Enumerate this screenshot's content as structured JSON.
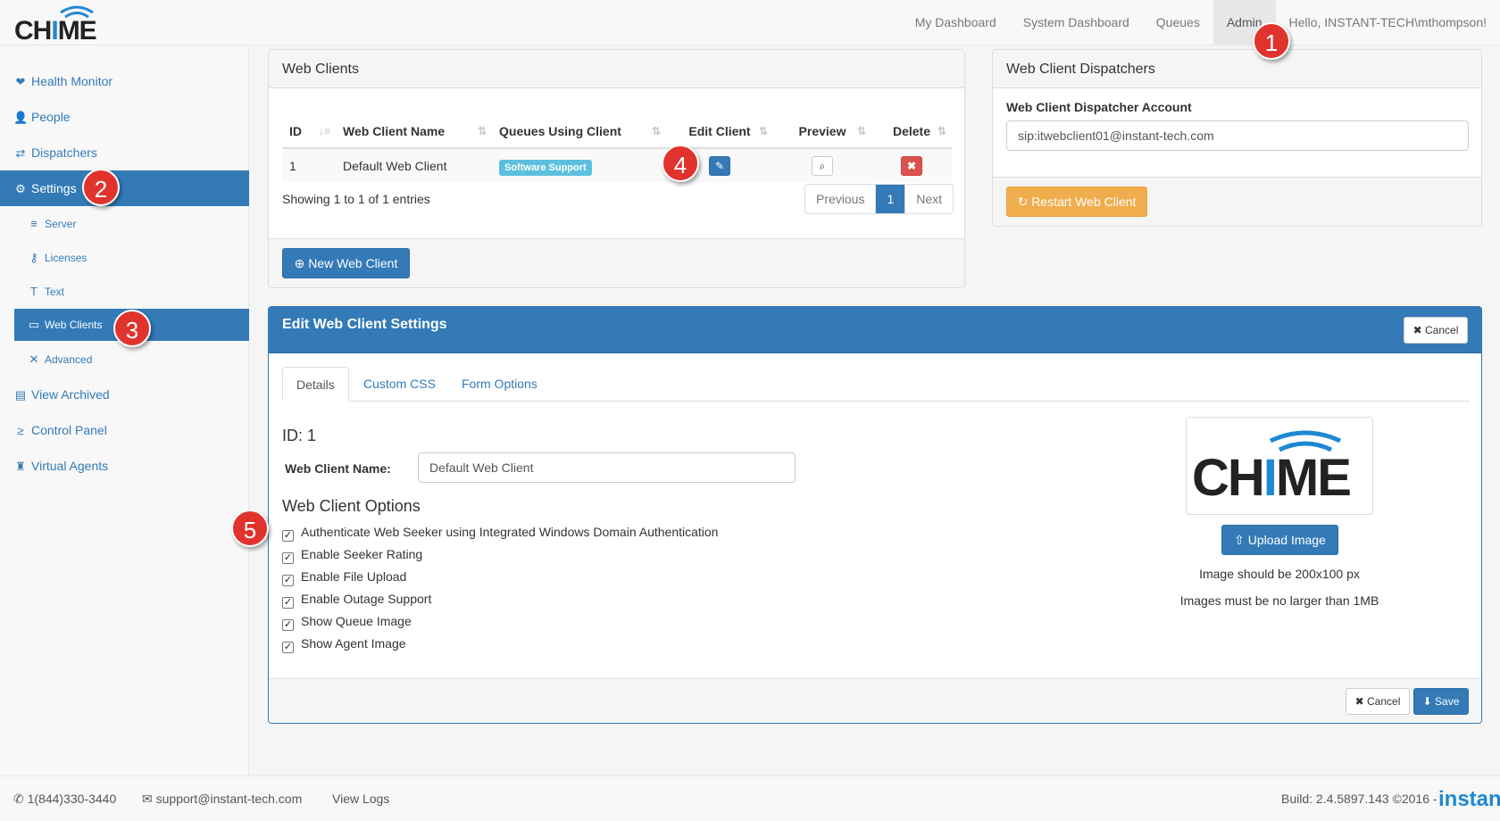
{
  "app": {
    "logo_text_left": "CH",
    "logo_text_i": "I",
    "logo_text_right": "ME"
  },
  "topnav": {
    "items": [
      "My Dashboard",
      "System Dashboard",
      "Queues",
      "Admin"
    ],
    "greeting": "Hello, INSTANT-TECH\\mthompson!"
  },
  "sidebar": {
    "items": [
      {
        "label": "Health Monitor",
        "icon": "heartbeat-icon",
        "glyph": "❤"
      },
      {
        "label": "People",
        "icon": "user-icon",
        "glyph": "👤"
      },
      {
        "label": "Dispatchers",
        "icon": "exchange-icon",
        "glyph": "⇄"
      },
      {
        "label": "Settings",
        "icon": "gear-icon",
        "glyph": "⚙"
      },
      {
        "label": "Server",
        "icon": "server-icon",
        "glyph": "≡"
      },
      {
        "label": "Licenses",
        "icon": "key-icon",
        "glyph": "⚷"
      },
      {
        "label": "Text",
        "icon": "text-icon",
        "glyph": "T"
      },
      {
        "label": "Web Clients",
        "icon": "comment-icon",
        "glyph": "▭"
      },
      {
        "label": "Advanced",
        "icon": "wrench-icon",
        "glyph": "✕"
      },
      {
        "label": "View Archived",
        "icon": "archive-icon",
        "glyph": "▤"
      },
      {
        "label": "Control Panel",
        "icon": "terminal-icon",
        "glyph": "≥"
      },
      {
        "label": "Virtual Agents",
        "icon": "android-icon",
        "glyph": "♜"
      }
    ]
  },
  "badges": [
    "1",
    "2",
    "3",
    "4",
    "5"
  ],
  "web_clients": {
    "title": "Web Clients",
    "columns": [
      "ID",
      "Web Client Name",
      "Queues Using Client",
      "Edit Client",
      "Preview",
      "Delete"
    ],
    "rows": [
      {
        "id": "1",
        "name": "Default Web Client",
        "queue": "Software Support"
      }
    ],
    "showing": "Showing 1 to 1 of 1 entries",
    "pager": {
      "prev": "Previous",
      "page": "1",
      "next": "Next"
    },
    "new_button": "New Web Client"
  },
  "dispatchers": {
    "title": "Web Client Dispatchers",
    "account_label": "Web Client Dispatcher Account",
    "account_value": "sip:itwebclient01@instant-tech.com",
    "restart_button": "Restart Web Client"
  },
  "edit": {
    "title": "Edit Web Client Settings",
    "cancel_top": "Cancel",
    "tabs": [
      "Details",
      "Custom CSS",
      "Form Options"
    ],
    "id_label": "ID: 1",
    "name_label": "Web Client Name:",
    "name_value": "Default Web Client",
    "options_heading": "Web Client Options",
    "options": [
      "Authenticate Web Seeker using Integrated Windows Domain Authentication",
      "Enable Seeker Rating",
      "Enable File Upload",
      "Enable Outage Support",
      "Show Queue Image",
      "Show Agent Image"
    ],
    "upload_button": "Upload Image",
    "image_hint_1": "Image should be 200x100 px",
    "image_hint_2": "Images must be no larger than 1MB",
    "cancel_bottom": "Cancel",
    "save": "Save"
  },
  "footer": {
    "phone": "1(844)330-3440",
    "email": "support@instant-tech.com",
    "logs": "View Logs",
    "build": "Build: 2.4.5897.143 ©2016 -",
    "brand": "instant"
  },
  "colors": {
    "primary": "#337ab7",
    "warning": "#f0ad4e",
    "danger": "#d9534f",
    "info": "#5bc0de",
    "badge": "#e0332e"
  }
}
